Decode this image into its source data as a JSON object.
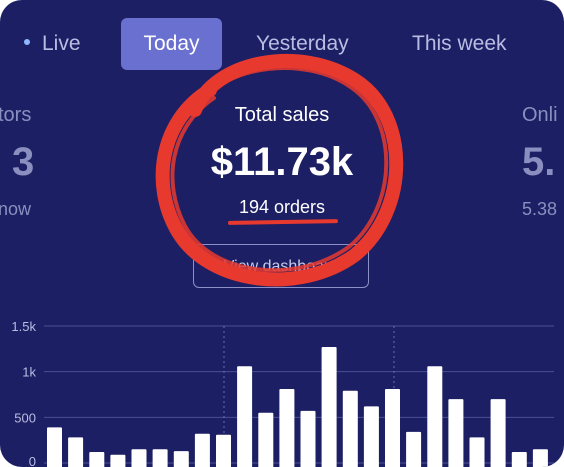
{
  "tabs": [
    {
      "label": "Live"
    },
    {
      "label": "Today",
      "active": true
    },
    {
      "label": "Yesterday"
    },
    {
      "label": "This week"
    }
  ],
  "stats": {
    "left": {
      "label": "tors",
      "value": "3",
      "sub": "now"
    },
    "center": {
      "label": "Total sales",
      "value": "$11.73k",
      "orders": "194 orders"
    },
    "right": {
      "label": "Onli",
      "value": "5.",
      "sub": "5.38"
    }
  },
  "view_dashboard_label": "View dashboard",
  "colors": {
    "background": "#1c1f63",
    "active_tab": "#6a70cf",
    "annotation_red": "#e8392e",
    "bars": "#ffffff"
  },
  "chart_data": {
    "type": "bar",
    "yticks": [
      "1.5k",
      "1k",
      "500",
      "0"
    ],
    "ylim": [
      0,
      1500
    ],
    "values": [
      390,
      280,
      120,
      90,
      150,
      150,
      130,
      320,
      310,
      1060,
      550,
      810,
      570,
      1270,
      790,
      620,
      810,
      340,
      1060,
      700,
      280,
      700,
      120,
      150
    ],
    "grid": true
  }
}
